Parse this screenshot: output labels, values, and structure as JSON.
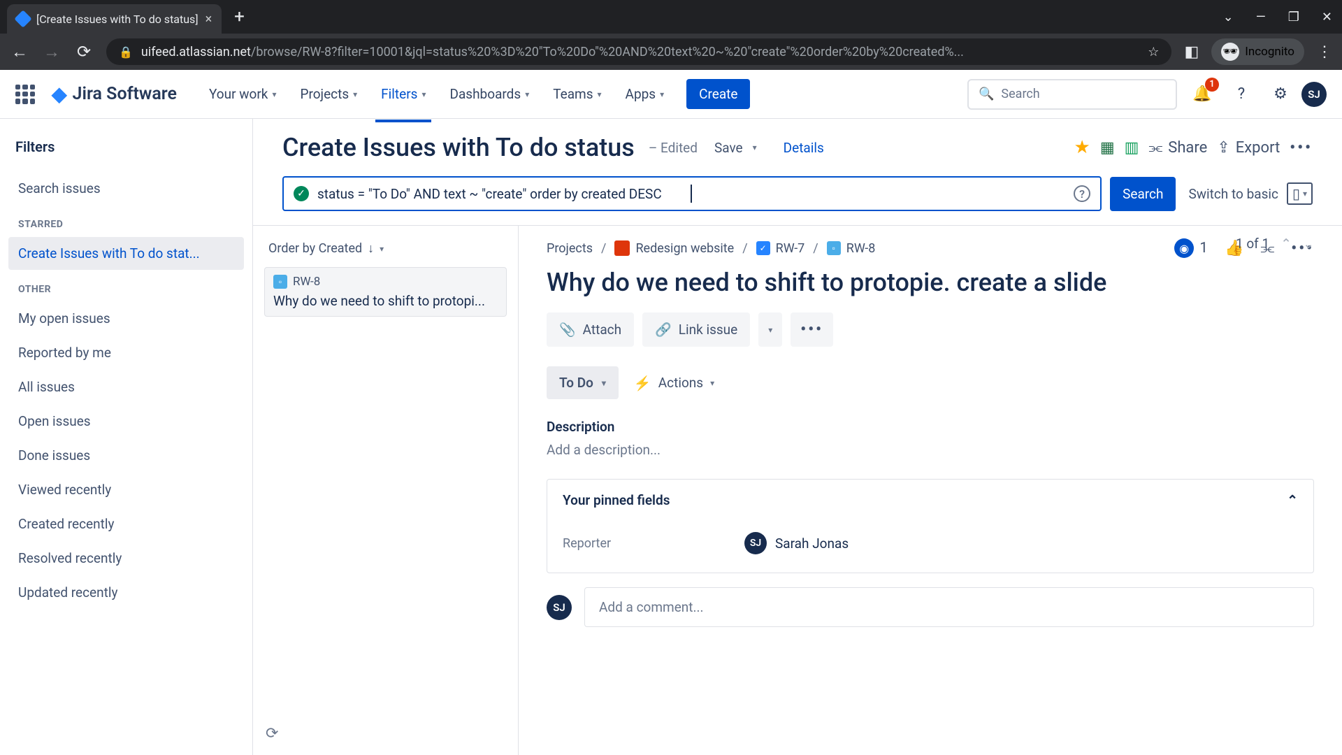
{
  "browser": {
    "tab_title": "[Create Issues with To do status]",
    "url_host": "uifeed.atlassian.net",
    "url_path": "/browse/RW-8?filter=10001&jql=status%20%3D%20\"To%20Do\"%20AND%20text%20~%20\"create\"%20order%20by%20created%...",
    "incognito": "Incognito"
  },
  "nav": {
    "product": "Jira Software",
    "items": [
      "Your work",
      "Projects",
      "Filters",
      "Dashboards",
      "Teams",
      "Apps"
    ],
    "create": "Create",
    "search_placeholder": "Search",
    "notification_count": "1",
    "avatar_initials": "SJ"
  },
  "sidebar": {
    "title": "Filters",
    "search_issues": "Search issues",
    "sections": {
      "starred": "STARRED",
      "other": "OTHER"
    },
    "starred_items": [
      "Create Issues with To do stat..."
    ],
    "other_items": [
      "My open issues",
      "Reported by me",
      "All issues",
      "Open issues",
      "Done issues",
      "Viewed recently",
      "Created recently",
      "Resolved recently",
      "Updated recently"
    ]
  },
  "filter": {
    "title": "Create Issues with To do status",
    "edited": "– Edited",
    "save": "Save",
    "details": "Details",
    "share": "Share",
    "export": "Export",
    "jql": "status = \"To Do\" AND text ~ \"create\" order by created DESC",
    "search": "Search",
    "switch": "Switch to basic"
  },
  "list": {
    "order_by": "Order by Created",
    "pagination": "1 of 1",
    "issues": [
      {
        "key": "RW-8",
        "summary": "Why do we need to shift to protopi..."
      }
    ]
  },
  "detail": {
    "breadcrumb": {
      "projects": "Projects",
      "project_name": "Redesign website",
      "parent_key": "RW-7",
      "issue_key": "RW-8"
    },
    "watch_count": "1",
    "title": "Why do we need to shift to protopie. create a slide",
    "attach": "Attach",
    "link_issue": "Link issue",
    "status": "To Do",
    "actions": "Actions",
    "description_label": "Description",
    "description_placeholder": "Add a description...",
    "pinned_label": "Your pinned fields",
    "reporter_label": "Reporter",
    "reporter_name": "Sarah Jonas",
    "reporter_initials": "SJ",
    "comment_placeholder": "Add a comment...",
    "comment_avatar": "SJ"
  }
}
